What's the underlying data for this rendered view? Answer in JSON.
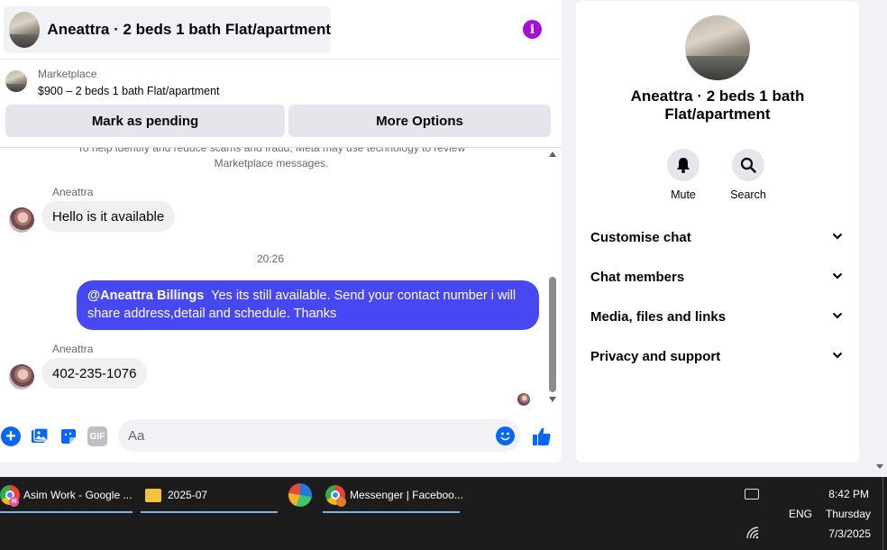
{
  "header": {
    "title": "Aneattra · 2 beds 1 bath Flat/apartment"
  },
  "listing": {
    "label": "Marketplace",
    "title": "$900 – 2 beds 1 bath Flat/apartment"
  },
  "actions": {
    "mark_pending": "Mark as pending",
    "more_options": "More Options"
  },
  "messages": {
    "notice": "To help identify and reduce scams and fraud, Meta may use technology to review Marketplace messages.",
    "first_sender": "Aneattra",
    "first_text": "Hello is it available",
    "timestamp": "20:26",
    "reply_mention": "@Aneattra Billings",
    "reply_text": "Yes its still available. Send your contact number i will share address,detail and schedule. Thanks",
    "second_sender": "Aneattra",
    "second_text": "402-235-1076"
  },
  "composer": {
    "placeholder": "Aa",
    "gif_label": "GIF"
  },
  "details": {
    "title": "Aneattra · 2 beds 1 bath Flat/apartment",
    "mute_label": "Mute",
    "search_label": "Search",
    "sections": [
      "Customise chat",
      "Chat members",
      "Media, files and links",
      "Privacy and support"
    ]
  },
  "taskbar": {
    "apps": [
      {
        "label": "Asim Work - Google ...",
        "badge": "H"
      },
      {
        "label": "2025-07"
      },
      {
        "label": ""
      },
      {
        "label": "Messenger | Faceboo..."
      }
    ],
    "lang": "ENG",
    "time": "8:42 PM",
    "day": "Thursday",
    "date": "7/3/2025"
  },
  "colors": {
    "accent": "#0866ff",
    "outgoing_bubble": "#4748f2",
    "info_icon": "#a30fd6",
    "taskbar": "#1c1c1c"
  },
  "icons": [
    "info-icon",
    "plus-icon",
    "gallery-icon",
    "sticker-icon",
    "gif-icon",
    "emoji-icon",
    "thumbs-up-icon",
    "bell-icon",
    "search-icon",
    "chevron-down-icon",
    "chrome-icon",
    "folder-icon",
    "edge-icon",
    "keyboard-icon",
    "wifi-icon"
  ]
}
